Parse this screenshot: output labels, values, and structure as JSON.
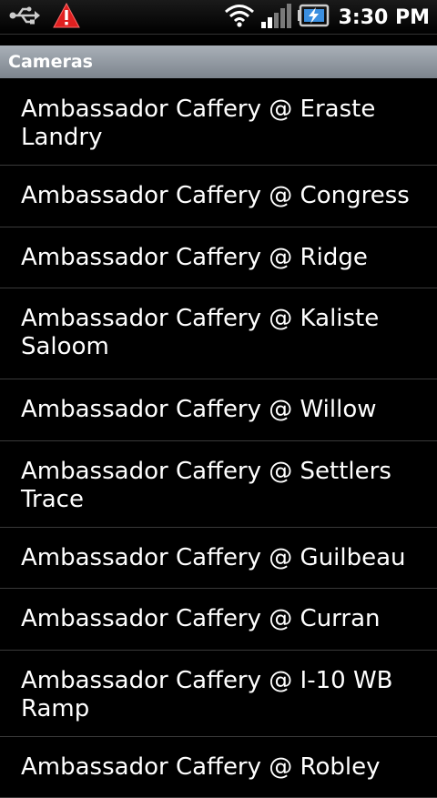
{
  "status_bar": {
    "time": "3:30 PM",
    "icons": [
      "usb-icon",
      "warning-icon",
      "wifi-icon",
      "signal-icon",
      "battery-charging-icon"
    ]
  },
  "section": {
    "title": "Cameras"
  },
  "cameras": [
    "Ambassador Caffery @ Eraste Landry",
    "Ambassador Caffery @ Congress",
    "Ambassador Caffery @ Ridge",
    "Ambassador Caffery @ Kaliste Saloom",
    "Ambassador Caffery @ Willow",
    "Ambassador Caffery @ Settlers Trace",
    "Ambassador Caffery @ Guilbeau",
    "Ambassador Caffery @ Curran",
    "Ambassador Caffery @ I-10 WB Ramp",
    "Ambassador Caffery @ Robley"
  ],
  "colors": {
    "background": "#000000",
    "header_gradient_top": "#a9b0b8",
    "header_gradient_bottom": "#7c848d",
    "divider": "#3a3a3a",
    "warning": "#e02020",
    "battery_charge": "#3b8fe0"
  }
}
